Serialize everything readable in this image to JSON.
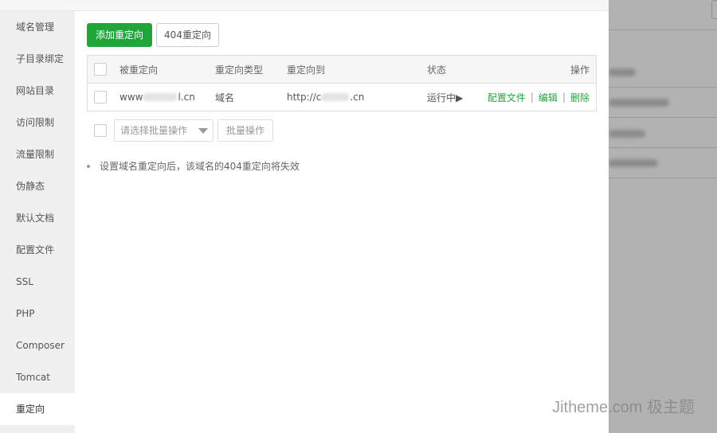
{
  "sidebar": {
    "items": [
      {
        "label": "域名管理"
      },
      {
        "label": "子目录绑定"
      },
      {
        "label": "网站目录"
      },
      {
        "label": "访问限制"
      },
      {
        "label": "流量限制"
      },
      {
        "label": "伪静态"
      },
      {
        "label": "默认文档"
      },
      {
        "label": "配置文件"
      },
      {
        "label": "SSL"
      },
      {
        "label": "PHP"
      },
      {
        "label": "Composer"
      },
      {
        "label": "Tomcat"
      },
      {
        "label": "重定向"
      }
    ],
    "active_index": 12
  },
  "toolbar": {
    "add_label": "添加重定向",
    "notfound_label": "404重定向"
  },
  "table": {
    "headers": {
      "source": "被重定向",
      "type": "重定向类型",
      "target": "重定向到",
      "status": "状态",
      "actions": "操作"
    },
    "rows": [
      {
        "source_prefix": "www",
        "source_suffix": "l.cn",
        "type": "域名",
        "target_prefix": "http://c",
        "target_suffix": ".cn",
        "status": "运行中▶",
        "action_config": "配置文件",
        "action_edit": "编辑",
        "action_delete": "删除",
        "separator": "|"
      }
    ]
  },
  "batch": {
    "select_placeholder": "请选择批量操作",
    "button_label": "批量操作"
  },
  "tips": {
    "text": "设置域名重定向后，该域名的404重定向将失效"
  },
  "watermark": {
    "text": "Jitheme.com 极主题"
  },
  "colors": {
    "accent": "#20a53a",
    "sidebar_bg": "#f0f0f0",
    "mask": "rgba(0,0,0,0.3)"
  }
}
